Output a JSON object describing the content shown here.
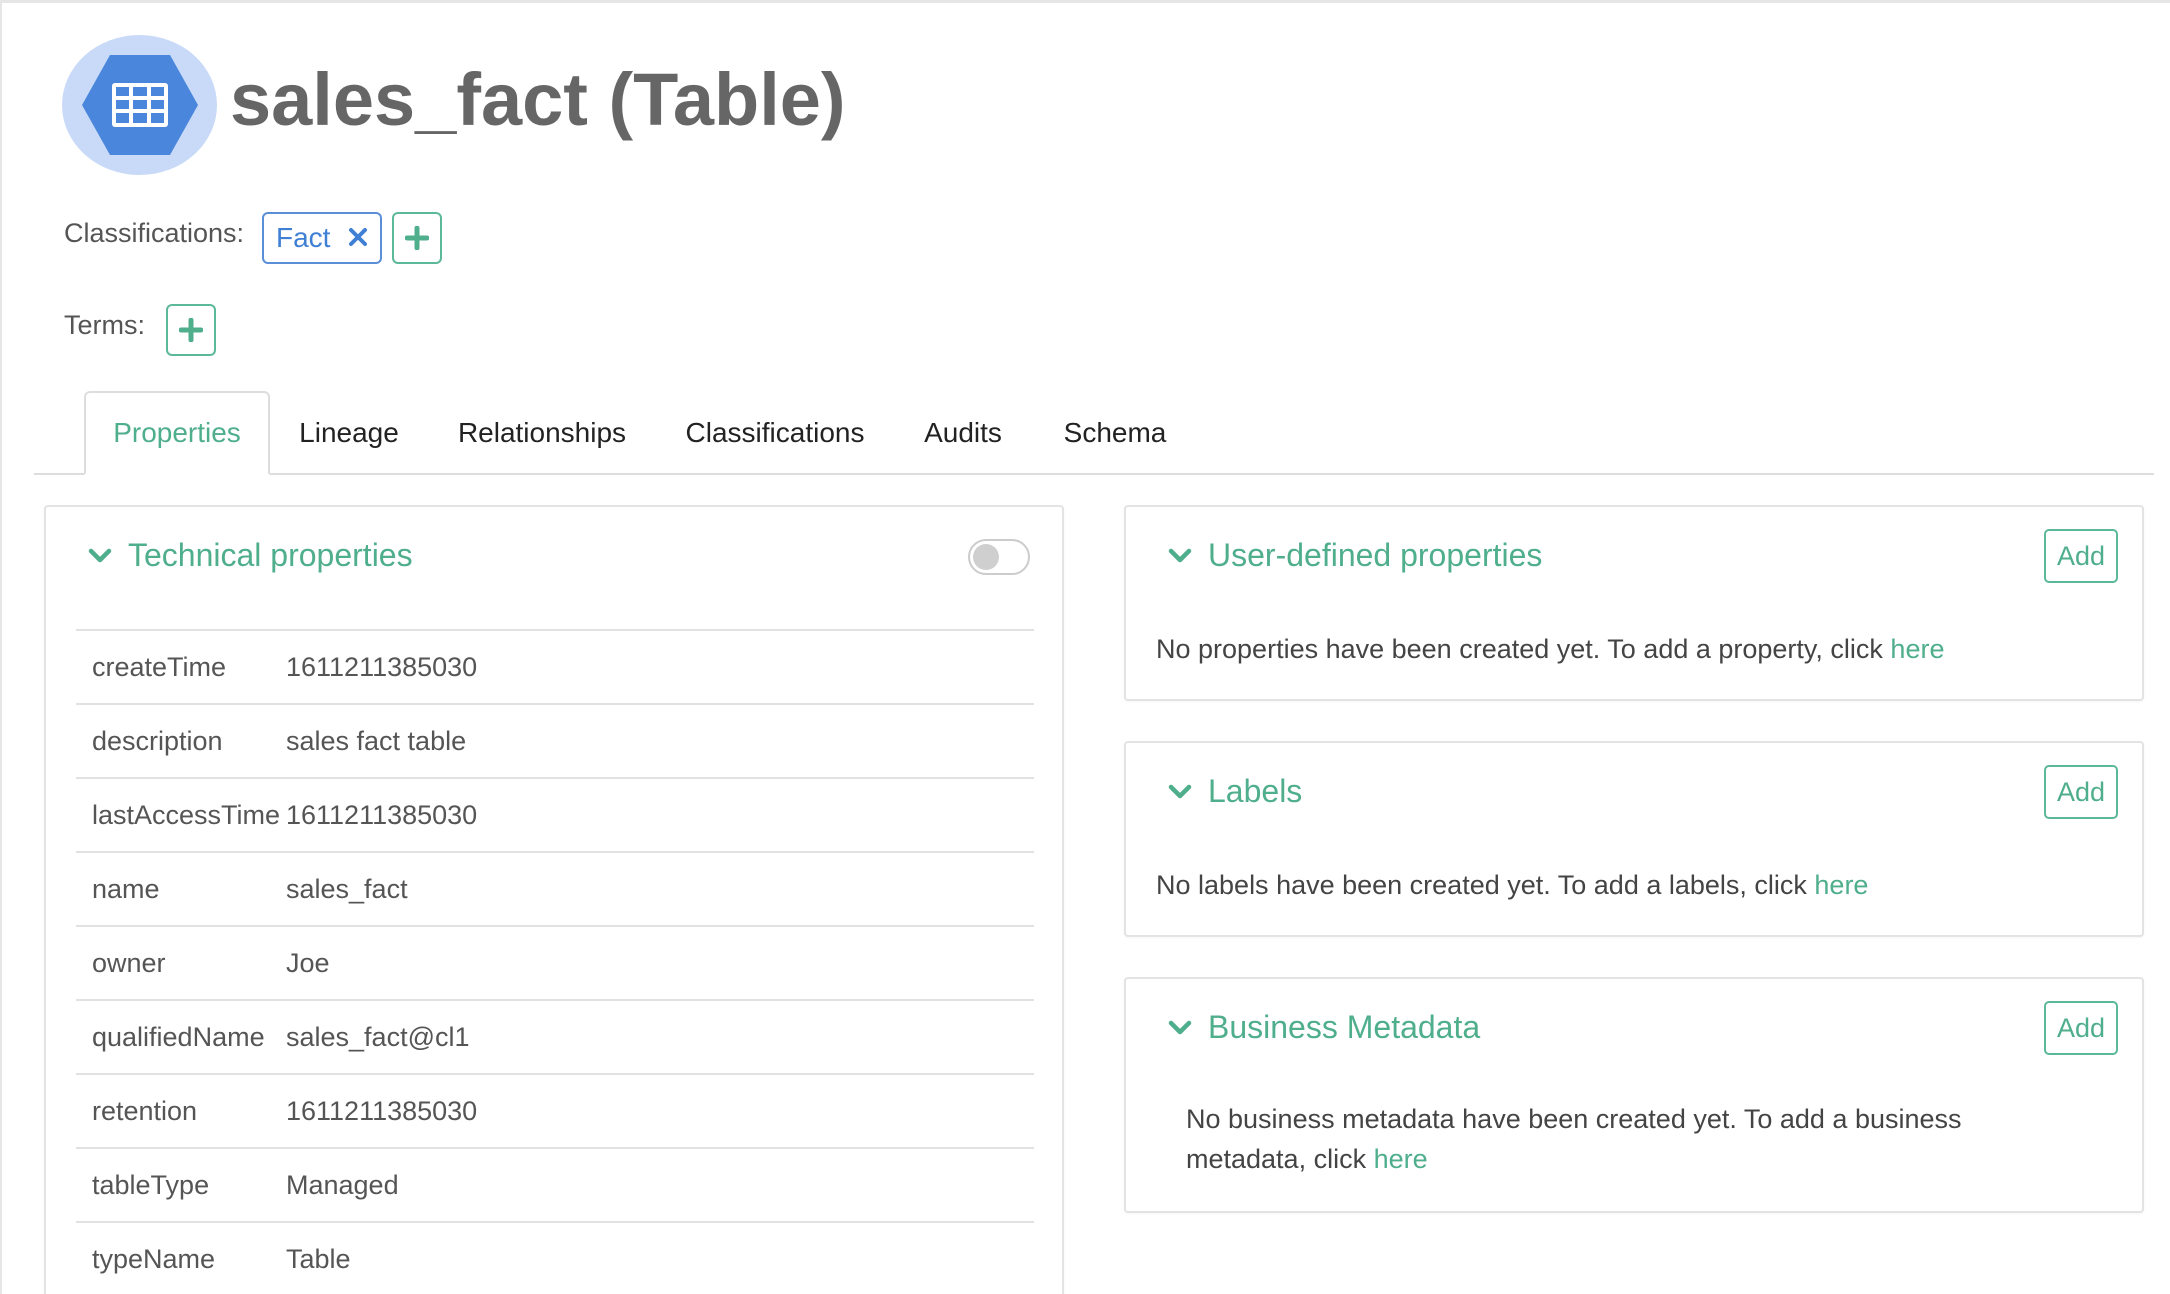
{
  "header": {
    "title": "sales_fact (Table)",
    "icon": "table-grid-icon",
    "icon_colors": {
      "circle": "#c8daf7",
      "hexagon": "#4a87dc"
    }
  },
  "classifications": {
    "label": "Classifications:",
    "tags": [
      {
        "label": "Fact"
      }
    ]
  },
  "terms": {
    "label": "Terms:"
  },
  "tabs": [
    {
      "label": "Properties",
      "active": true
    },
    {
      "label": "Lineage"
    },
    {
      "label": "Relationships"
    },
    {
      "label": "Classifications"
    },
    {
      "label": "Audits"
    },
    {
      "label": "Schema"
    }
  ],
  "technical": {
    "title": "Technical properties",
    "toggle_on": false,
    "rows": [
      {
        "key": "createTime",
        "value": "1611211385030"
      },
      {
        "key": "description",
        "value": "sales fact table"
      },
      {
        "key": "lastAccessTime",
        "value": "1611211385030"
      },
      {
        "key": "name",
        "value": "sales_fact"
      },
      {
        "key": "owner",
        "value": "Joe"
      },
      {
        "key": "qualifiedName",
        "value": "sales_fact@cl1"
      },
      {
        "key": "retention",
        "value": "1611211385030"
      },
      {
        "key": "tableType",
        "value": "Managed"
      },
      {
        "key": "typeName",
        "value": "Table"
      }
    ]
  },
  "user_defined": {
    "title": "User-defined properties",
    "add_label": "Add",
    "message": "No properties have been created yet. To add a property, click ",
    "link": "here"
  },
  "labels": {
    "title": "Labels",
    "add_label": "Add",
    "message": "No labels have been created yet. To add a labels, click ",
    "link": "here"
  },
  "business_metadata": {
    "title": "Business Metadata",
    "add_label": "Add",
    "message": "No business metadata have been created yet. To add a business metadata, click ",
    "link": "here"
  },
  "colors": {
    "accent": "#4fae8c",
    "tag_blue": "#3f7fd4",
    "title_gray": "#666666"
  }
}
